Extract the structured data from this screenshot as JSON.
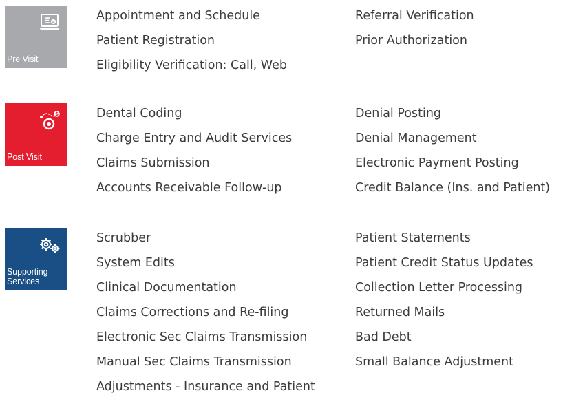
{
  "colors": {
    "pre_visit": "#a7a9ac",
    "post_visit": "#e51e2f",
    "supporting_services": "#1a4f86",
    "text": "#3b3b3b"
  },
  "sections": [
    {
      "tile": {
        "label": "Pre Visit",
        "icon": "laptop-check-icon"
      },
      "left_items": [
        "Appointment and Schedule",
        "Patient Registration",
        "Eligibility Verification: Call, Web"
      ],
      "right_items": [
        "Referral Verification",
        "Prior Authorization"
      ]
    },
    {
      "tile": {
        "label": "Post Visit",
        "icon": "dollar-route-target-icon"
      },
      "left_items": [
        "Dental Coding",
        "Charge Entry and Audit Services",
        "Claims Submission",
        "Accounts Receivable Follow-up"
      ],
      "right_items": [
        "Denial Posting",
        "Denial Management",
        "Electronic Payment Posting",
        "Credit Balance (Ins. and Patient)"
      ]
    },
    {
      "tile": {
        "label": "Supporting Services",
        "icon": "gears-icon"
      },
      "left_items": [
        "Scrubber",
        "System Edits",
        "Clinical Documentation",
        "Claims Corrections and Re-filing",
        "Electronic Sec Claims Transmission",
        "Manual Sec Claims Transmission",
        "Adjustments - Insurance and Patient"
      ],
      "right_items": [
        "Patient Statements",
        "Patient Credit Status Updates",
        "Collection Letter Processing",
        "Returned Mails",
        "Bad Debt",
        "Small Balance Adjustment"
      ]
    }
  ]
}
